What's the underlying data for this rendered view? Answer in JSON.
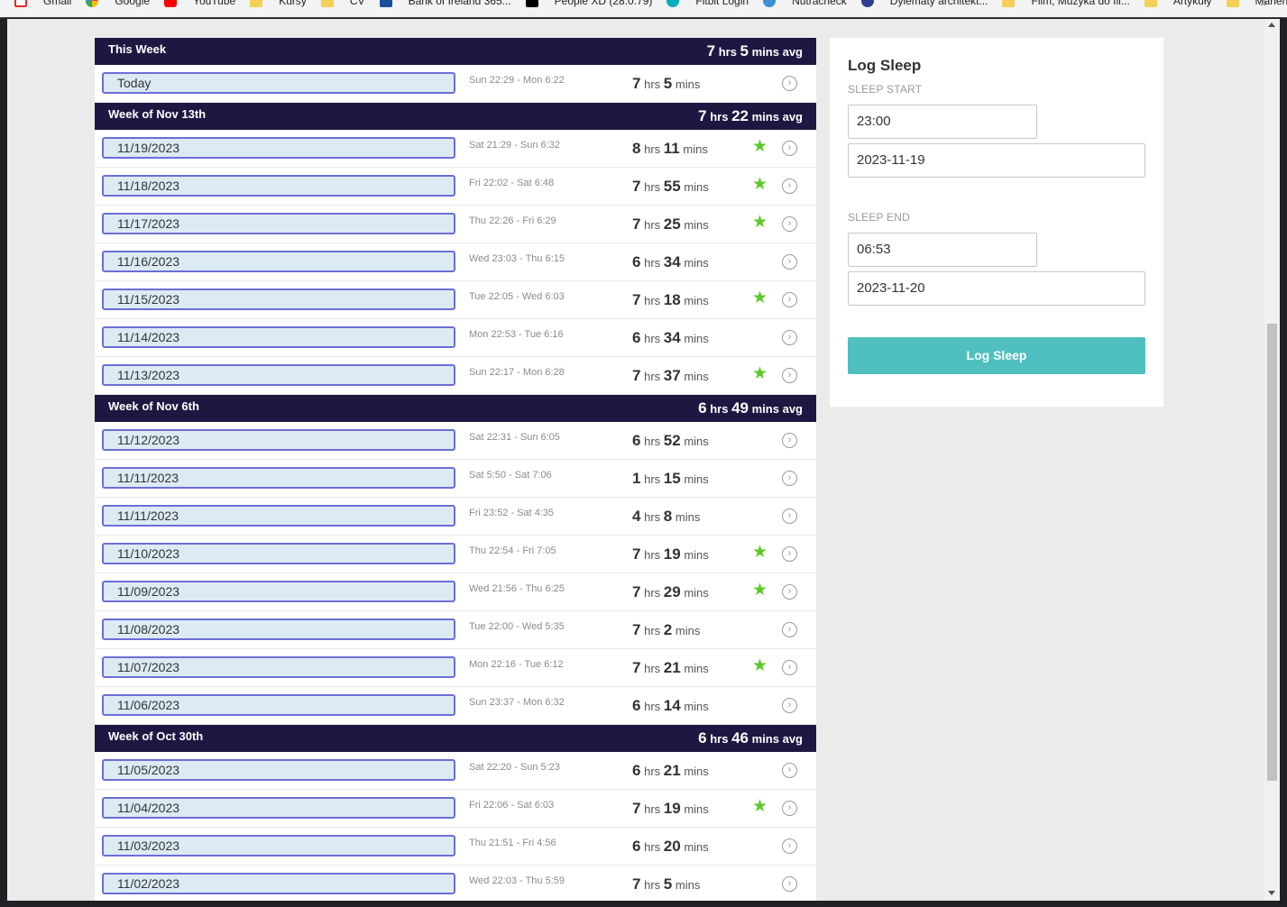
{
  "bookmarks": [
    {
      "label": "Gmail",
      "icon": "gmail"
    },
    {
      "label": "Google",
      "icon": "google"
    },
    {
      "label": "YouTube",
      "icon": "yt"
    },
    {
      "label": "Kursy",
      "icon": "folder"
    },
    {
      "label": "CV",
      "icon": "folder"
    },
    {
      "label": "Bank of Ireland 365...",
      "icon": "boi"
    },
    {
      "label": "People XD (28.0.79)",
      "icon": "x"
    },
    {
      "label": "Fitbit Login",
      "icon": "fitbit"
    },
    {
      "label": "Nutracheck",
      "icon": "nutra"
    },
    {
      "label": "Dylematy architekt...",
      "icon": "dyl"
    },
    {
      "label": "Film, Muzyka do fil...",
      "icon": "folder"
    },
    {
      "label": "Artykuły",
      "icon": "folder"
    },
    {
      "label": "Mariena",
      "icon": "folder"
    }
  ],
  "bookmarks_more": "»",
  "units": {
    "hrs": "hrs",
    "mins": "mins",
    "avg": "mins avg"
  },
  "weeks": [
    {
      "title": "This Week",
      "avg_h": "7",
      "avg_m": "5",
      "entries": [
        {
          "date": "Today",
          "span": "Sun 22:29 - Mon 6:22",
          "h": "7",
          "m": "5",
          "star": false
        }
      ]
    },
    {
      "title": "Week of Nov 13th",
      "avg_h": "7",
      "avg_m": "22",
      "entries": [
        {
          "date": "11/19/2023",
          "span": "Sat 21:29 - Sun 6:32",
          "h": "8",
          "m": "11",
          "star": true
        },
        {
          "date": "11/18/2023",
          "span": "Fri 22:02 - Sat 6:48",
          "h": "7",
          "m": "55",
          "star": true
        },
        {
          "date": "11/17/2023",
          "span": "Thu 22:26 - Fri 6:29",
          "h": "7",
          "m": "25",
          "star": true
        },
        {
          "date": "11/16/2023",
          "span": "Wed 23:03 - Thu 6:15",
          "h": "6",
          "m": "34",
          "star": false
        },
        {
          "date": "11/15/2023",
          "span": "Tue 22:05 - Wed 6:03",
          "h": "7",
          "m": "18",
          "star": true
        },
        {
          "date": "11/14/2023",
          "span": "Mon 22:53 - Tue 6:16",
          "h": "6",
          "m": "34",
          "star": false
        },
        {
          "date": "11/13/2023",
          "span": "Sun 22:17 - Mon 6:28",
          "h": "7",
          "m": "37",
          "star": true
        }
      ]
    },
    {
      "title": "Week of Nov 6th",
      "avg_h": "6",
      "avg_m": "49",
      "entries": [
        {
          "date": "11/12/2023",
          "span": "Sat 22:31 - Sun 6:05",
          "h": "6",
          "m": "52",
          "star": false
        },
        {
          "date": "11/11/2023",
          "span": "Sat 5:50 - Sat 7:06",
          "h": "1",
          "m": "15",
          "star": false
        },
        {
          "date": "11/11/2023",
          "span": "Fri 23:52 - Sat 4:35",
          "h": "4",
          "m": "8",
          "star": false
        },
        {
          "date": "11/10/2023",
          "span": "Thu 22:54 - Fri 7:05",
          "h": "7",
          "m": "19",
          "star": true
        },
        {
          "date": "11/09/2023",
          "span": "Wed 21:56 - Thu 6:25",
          "h": "7",
          "m": "29",
          "star": true
        },
        {
          "date": "11/08/2023",
          "span": "Tue 22:00 - Wed 5:35",
          "h": "7",
          "m": "2",
          "star": false
        },
        {
          "date": "11/07/2023",
          "span": "Mon 22:16 - Tue 6:12",
          "h": "7",
          "m": "21",
          "star": true
        },
        {
          "date": "11/06/2023",
          "span": "Sun 23:37 - Mon 6:32",
          "h": "6",
          "m": "14",
          "star": false
        }
      ]
    },
    {
      "title": "Week of Oct 30th",
      "avg_h": "6",
      "avg_m": "46",
      "entries": [
        {
          "date": "11/05/2023",
          "span": "Sat 22:20 - Sun 5:23",
          "h": "6",
          "m": "21",
          "star": false
        },
        {
          "date": "11/04/2023",
          "span": "Fri 22:06 - Sat 6:03",
          "h": "7",
          "m": "19",
          "star": true
        },
        {
          "date": "11/03/2023",
          "span": "Thu 21:51 - Fri 4:56",
          "h": "6",
          "m": "20",
          "star": false
        },
        {
          "date": "11/02/2023",
          "span": "Wed 22:03 - Thu 5:59",
          "h": "7",
          "m": "5",
          "star": false
        }
      ]
    }
  ],
  "form": {
    "title": "Log Sleep",
    "start_label": "SLEEP START",
    "start_time": "23:00",
    "start_date": "2023-11-19",
    "end_label": "SLEEP END",
    "end_time": "06:53",
    "end_date": "2023-11-20",
    "button": "Log Sleep"
  },
  "colors": {
    "header_bg": "#1d1841",
    "star": "#5ec829",
    "button": "#4fc0bf",
    "date_border": "#6c6ed6",
    "date_bg": "#dcebf3"
  }
}
